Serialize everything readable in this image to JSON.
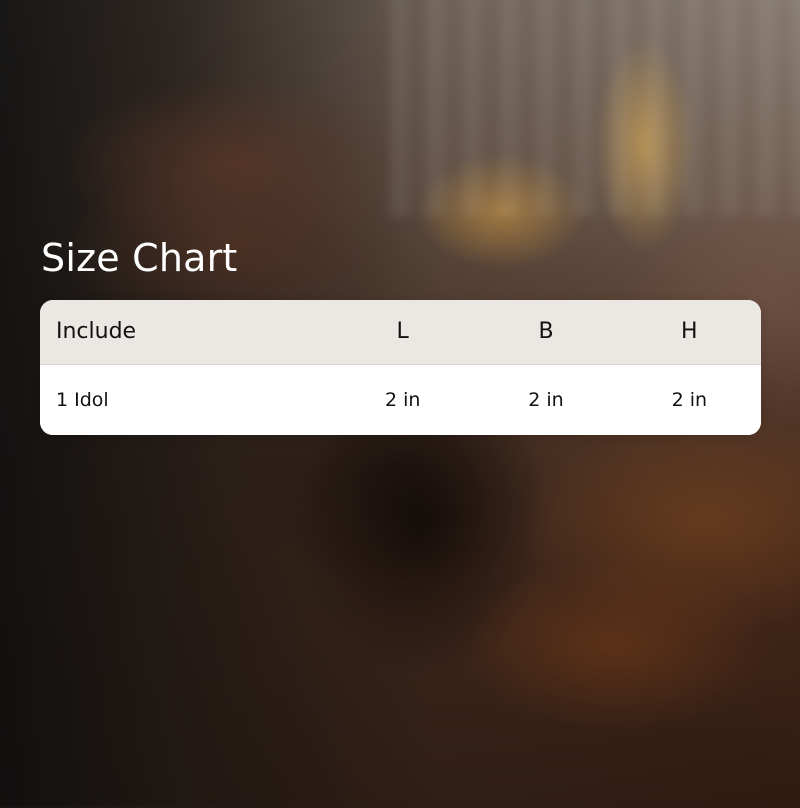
{
  "title": "Size Chart",
  "table": {
    "headers": [
      "Include",
      "L",
      "B",
      "H"
    ],
    "rows": [
      [
        "1 Idol",
        "2 in",
        "2 in",
        "2 in"
      ]
    ]
  }
}
